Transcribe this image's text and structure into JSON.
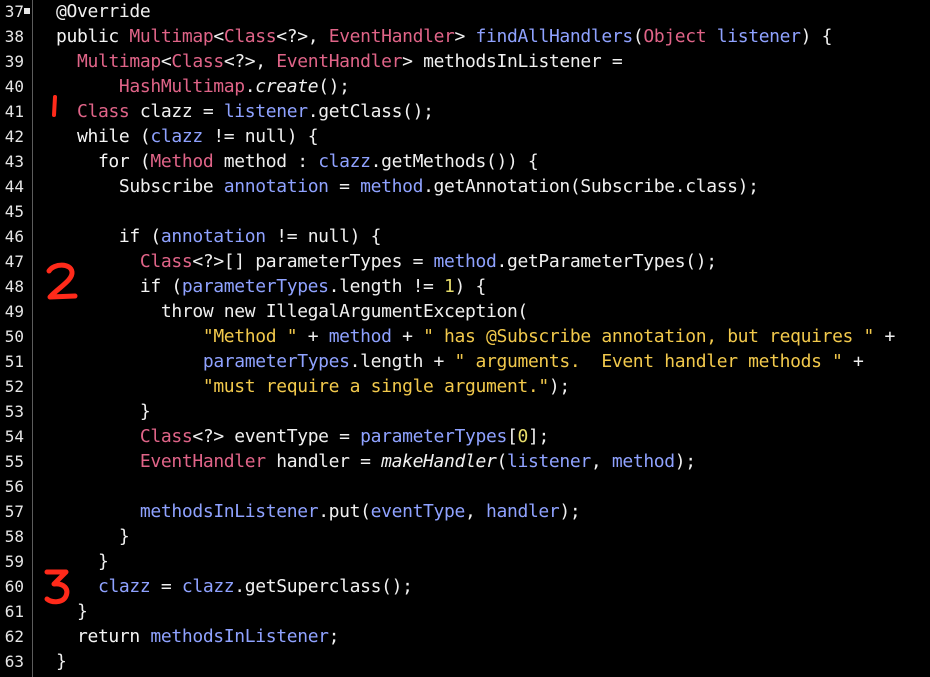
{
  "editor": {
    "lines": [
      {
        "n": "37",
        "fold": true,
        "tokens": [
          {
            "t": "@Override",
            "c": "plain"
          }
        ]
      },
      {
        "n": "38",
        "tokens": [
          {
            "t": "public ",
            "c": "kw"
          },
          {
            "t": "Multimap",
            "c": "type"
          },
          {
            "t": "<",
            "c": "plain"
          },
          {
            "t": "Class",
            "c": "type"
          },
          {
            "t": "<?>, ",
            "c": "plain"
          },
          {
            "t": "EventHandler",
            "c": "type"
          },
          {
            "t": "> ",
            "c": "plain"
          },
          {
            "t": "findAllHandlers",
            "c": "id"
          },
          {
            "t": "(",
            "c": "plain"
          },
          {
            "t": "Object",
            "c": "type"
          },
          {
            "t": " listener",
            "c": "id"
          },
          {
            "t": ") {",
            "c": "plain"
          }
        ]
      },
      {
        "n": "39",
        "tokens": [
          {
            "t": "  ",
            "c": "plain"
          },
          {
            "t": "Multimap",
            "c": "type"
          },
          {
            "t": "<",
            "c": "plain"
          },
          {
            "t": "Class",
            "c": "type"
          },
          {
            "t": "<?>, ",
            "c": "plain"
          },
          {
            "t": "EventHandler",
            "c": "type"
          },
          {
            "t": "> methodsInListener =",
            "c": "plain"
          }
        ]
      },
      {
        "n": "40",
        "tokens": [
          {
            "t": "      ",
            "c": "plain"
          },
          {
            "t": "HashMultimap",
            "c": "type"
          },
          {
            "t": ".",
            "c": "plain"
          },
          {
            "t": "create",
            "c": "plain",
            "i": true
          },
          {
            "t": "();",
            "c": "plain"
          }
        ]
      },
      {
        "n": "41",
        "tokens": [
          {
            "t": "  ",
            "c": "plain"
          },
          {
            "t": "Class",
            "c": "type"
          },
          {
            "t": " clazz = ",
            "c": "plain"
          },
          {
            "t": "listener",
            "c": "id"
          },
          {
            "t": ".getClass();",
            "c": "plain"
          }
        ]
      },
      {
        "n": "42",
        "tokens": [
          {
            "t": "  while (",
            "c": "kw"
          },
          {
            "t": "clazz",
            "c": "id"
          },
          {
            "t": " != null) {",
            "c": "plain"
          }
        ]
      },
      {
        "n": "43",
        "tokens": [
          {
            "t": "    for (",
            "c": "kw"
          },
          {
            "t": "Method",
            "c": "type"
          },
          {
            "t": " method : ",
            "c": "plain"
          },
          {
            "t": "clazz",
            "c": "id"
          },
          {
            "t": ".getMethods()) {",
            "c": "plain"
          }
        ]
      },
      {
        "n": "44",
        "tokens": [
          {
            "t": "      Subscribe ",
            "c": "plain"
          },
          {
            "t": "annotation",
            "c": "id"
          },
          {
            "t": " = ",
            "c": "plain"
          },
          {
            "t": "method",
            "c": "id"
          },
          {
            "t": ".getAnnotation(Subscribe.class);",
            "c": "plain"
          }
        ]
      },
      {
        "n": "45",
        "tokens": []
      },
      {
        "n": "46",
        "tokens": [
          {
            "t": "      if (",
            "c": "kw"
          },
          {
            "t": "annotation",
            "c": "id"
          },
          {
            "t": " != null) {",
            "c": "plain"
          }
        ]
      },
      {
        "n": "47",
        "tokens": [
          {
            "t": "        ",
            "c": "plain"
          },
          {
            "t": "Class",
            "c": "type"
          },
          {
            "t": "<?>[] parameterTypes = ",
            "c": "plain"
          },
          {
            "t": "method",
            "c": "id"
          },
          {
            "t": ".getParameterTypes();",
            "c": "plain"
          }
        ]
      },
      {
        "n": "48",
        "tokens": [
          {
            "t": "        if (",
            "c": "kw"
          },
          {
            "t": "parameterTypes",
            "c": "id"
          },
          {
            "t": ".length != ",
            "c": "plain"
          },
          {
            "t": "1",
            "c": "num"
          },
          {
            "t": ") {",
            "c": "plain"
          }
        ]
      },
      {
        "n": "49",
        "tokens": [
          {
            "t": "          throw new IllegalArgumentException(",
            "c": "plain"
          }
        ]
      },
      {
        "n": "50",
        "tokens": [
          {
            "t": "              ",
            "c": "plain"
          },
          {
            "t": "\"Method \"",
            "c": "str"
          },
          {
            "t": " + ",
            "c": "plain"
          },
          {
            "t": "method",
            "c": "id"
          },
          {
            "t": " + ",
            "c": "plain"
          },
          {
            "t": "\" has @Subscribe annotation, but requires \"",
            "c": "str"
          },
          {
            "t": " +",
            "c": "plain"
          }
        ]
      },
      {
        "n": "51",
        "tokens": [
          {
            "t": "              ",
            "c": "plain"
          },
          {
            "t": "parameterTypes",
            "c": "id"
          },
          {
            "t": ".length + ",
            "c": "plain"
          },
          {
            "t": "\" arguments.  Event handler methods \"",
            "c": "str"
          },
          {
            "t": " +",
            "c": "plain"
          }
        ]
      },
      {
        "n": "52",
        "tokens": [
          {
            "t": "              ",
            "c": "plain"
          },
          {
            "t": "\"must require a single argument.\"",
            "c": "str"
          },
          {
            "t": ");",
            "c": "plain"
          }
        ]
      },
      {
        "n": "53",
        "tokens": [
          {
            "t": "        }",
            "c": "plain"
          }
        ]
      },
      {
        "n": "54",
        "tokens": [
          {
            "t": "        ",
            "c": "plain"
          },
          {
            "t": "Class",
            "c": "type"
          },
          {
            "t": "<?> eventType = ",
            "c": "plain"
          },
          {
            "t": "parameterTypes",
            "c": "id"
          },
          {
            "t": "[",
            "c": "plain"
          },
          {
            "t": "0",
            "c": "num"
          },
          {
            "t": "];",
            "c": "plain"
          }
        ]
      },
      {
        "n": "55",
        "tokens": [
          {
            "t": "        ",
            "c": "plain"
          },
          {
            "t": "EventHandler",
            "c": "type"
          },
          {
            "t": " handler = ",
            "c": "plain"
          },
          {
            "t": "makeHandler",
            "c": "plain",
            "i": true
          },
          {
            "t": "(",
            "c": "plain"
          },
          {
            "t": "listener",
            "c": "id"
          },
          {
            "t": ", ",
            "c": "plain"
          },
          {
            "t": "method",
            "c": "id"
          },
          {
            "t": ");",
            "c": "plain"
          }
        ]
      },
      {
        "n": "56",
        "tokens": []
      },
      {
        "n": "57",
        "tokens": [
          {
            "t": "        ",
            "c": "plain"
          },
          {
            "t": "methodsInListener",
            "c": "id"
          },
          {
            "t": ".put(",
            "c": "plain"
          },
          {
            "t": "eventType",
            "c": "id"
          },
          {
            "t": ", ",
            "c": "plain"
          },
          {
            "t": "handler",
            "c": "id"
          },
          {
            "t": ");",
            "c": "plain"
          }
        ]
      },
      {
        "n": "58",
        "tokens": [
          {
            "t": "      }",
            "c": "plain"
          }
        ]
      },
      {
        "n": "59",
        "tokens": [
          {
            "t": "    }",
            "c": "plain"
          }
        ]
      },
      {
        "n": "60",
        "tokens": [
          {
            "t": "    ",
            "c": "plain"
          },
          {
            "t": "clazz",
            "c": "id"
          },
          {
            "t": " = ",
            "c": "plain"
          },
          {
            "t": "clazz",
            "c": "id"
          },
          {
            "t": ".getSuperclass();",
            "c": "plain"
          }
        ]
      },
      {
        "n": "61",
        "tokens": [
          {
            "t": "  }",
            "c": "plain"
          }
        ]
      },
      {
        "n": "62",
        "tokens": [
          {
            "t": "  return ",
            "c": "kw"
          },
          {
            "t": "methodsInListener",
            "c": "id"
          },
          {
            "t": ";",
            "c": "plain"
          }
        ]
      },
      {
        "n": "63",
        "tokens": [
          {
            "t": "}",
            "c": "plain"
          }
        ]
      }
    ]
  },
  "annotations": [
    {
      "label": "1",
      "color": "#ff2a1a"
    },
    {
      "label": "2",
      "color": "#ff2a1a"
    },
    {
      "label": "3",
      "color": "#ff2a1a"
    }
  ]
}
